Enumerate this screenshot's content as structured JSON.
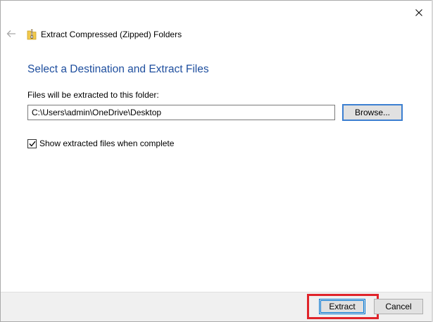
{
  "window": {
    "title": "Extract Compressed (Zipped) Folders",
    "close_icon": "close-icon",
    "back_icon": "back-arrow-icon",
    "title_icon": "zip-folder-icon"
  },
  "main": {
    "heading": "Select a Destination and Extract Files",
    "folder_label": "Files will be extracted to this folder:",
    "path_value": "C:\\Users\\admin\\OneDrive\\Desktop",
    "browse_label": "Browse...",
    "show_files": {
      "label": "Show extracted files when complete",
      "checked": true
    }
  },
  "footer": {
    "extract_label": "Extract",
    "cancel_label": "Cancel"
  },
  "colors": {
    "heading": "#1e4e9e",
    "focus_border": "#0078d7",
    "highlight": "#e0242a",
    "footer_bg": "#f0f0f0"
  }
}
